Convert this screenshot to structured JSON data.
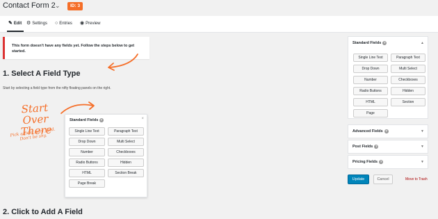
{
  "header": {
    "form_title": "Contact Form 2",
    "id_badge": "ID: 3",
    "accent_color": "#f56e28"
  },
  "tabs": [
    {
      "label": "Edit",
      "icon": "edit-icon",
      "active": true
    },
    {
      "label": "Settings",
      "icon": "gear-icon",
      "active": false
    },
    {
      "label": "Entries",
      "icon": "comment-icon",
      "active": false
    },
    {
      "label": "Preview",
      "icon": "eye-icon",
      "active": false
    }
  ],
  "notice": {
    "text": "This form doesn't have any fields yet. Follow the steps below to get started.",
    "border_color": "#dc3232"
  },
  "main": {
    "step1_heading": "1. Select A Field Type",
    "step1_text": "Start by selecting a field type from the nifty floating panels on the right.",
    "step2_heading": "2. Click to Add A Field"
  },
  "handwriting": {
    "big": "Start Over There",
    "small": "Pick a field, any field. Don't be shy."
  },
  "illustration_panel": {
    "title": "Standard Fields",
    "close": "×",
    "buttons": [
      "Single Line Text",
      "Paragraph Text",
      "Drop Down",
      "Multi Select",
      "Number",
      "Checkboxes",
      "Radio Buttons",
      "Hidden",
      "HTML",
      "Section Break",
      "Page Break"
    ]
  },
  "sidebar": {
    "standard": {
      "title": "Standard Fields",
      "buttons": [
        "Single Line Text",
        "Paragraph Text",
        "Drop Down",
        "Multi Select",
        "Number",
        "Checkboxes",
        "Radio Buttons",
        "Hidden",
        "HTML",
        "Section",
        "Page"
      ]
    },
    "advanced_title": "Advanced Fields",
    "post_title": "Post Fields",
    "pricing_title": "Pricing Fields",
    "update_label": "Update",
    "cancel_label": "Cancel",
    "trash_label": "Move to Trash",
    "primary_color": "#0085ba"
  }
}
